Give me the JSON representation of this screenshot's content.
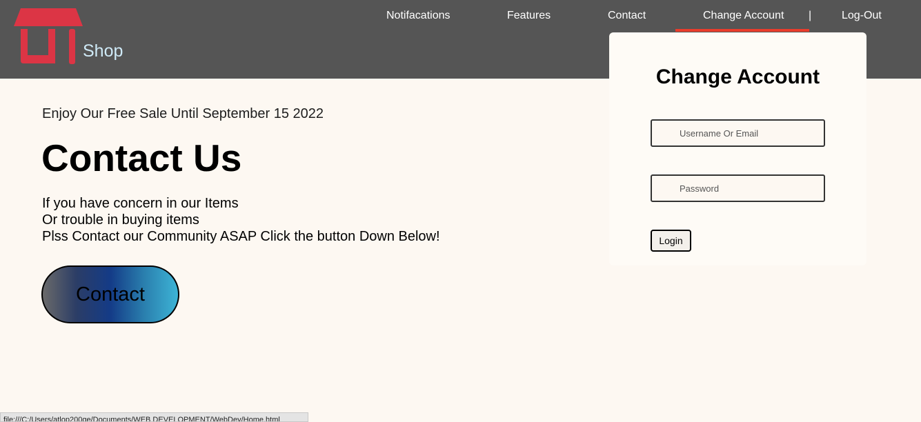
{
  "header": {
    "brand": "Shop",
    "logo_icon": "shop-storefront-icon",
    "colors": {
      "background": "#555555",
      "accent": "#ea3c2c",
      "logo": "#dc3545",
      "brand_text": "#cfeaf7"
    },
    "nav": {
      "notifications": "Notifacations",
      "features": "Features",
      "contact": "Contact",
      "change_account": "Change Account",
      "separator": "|",
      "logout": "Log-Out"
    },
    "active_item": "Change Account"
  },
  "main": {
    "promo": "Enjoy Our Free Sale Until September 15 2022",
    "title": "Contact Us",
    "lines": [
      "If you have concern in our Items",
      "Or trouble in buying items",
      "Plss Contact our Community ASAP Click the button Down Below!"
    ],
    "contact_button": "Contact"
  },
  "account_panel": {
    "title": "Change Account",
    "username_placeholder": "Username Or Email",
    "username_value": "",
    "password_placeholder": "Password",
    "password_value": "",
    "login_button": "Login"
  },
  "statusbar": {
    "url": "file:///C:/Users/atlop200ge/Documents/WEB DEVELOPMENT/WebDev/Home.html"
  }
}
